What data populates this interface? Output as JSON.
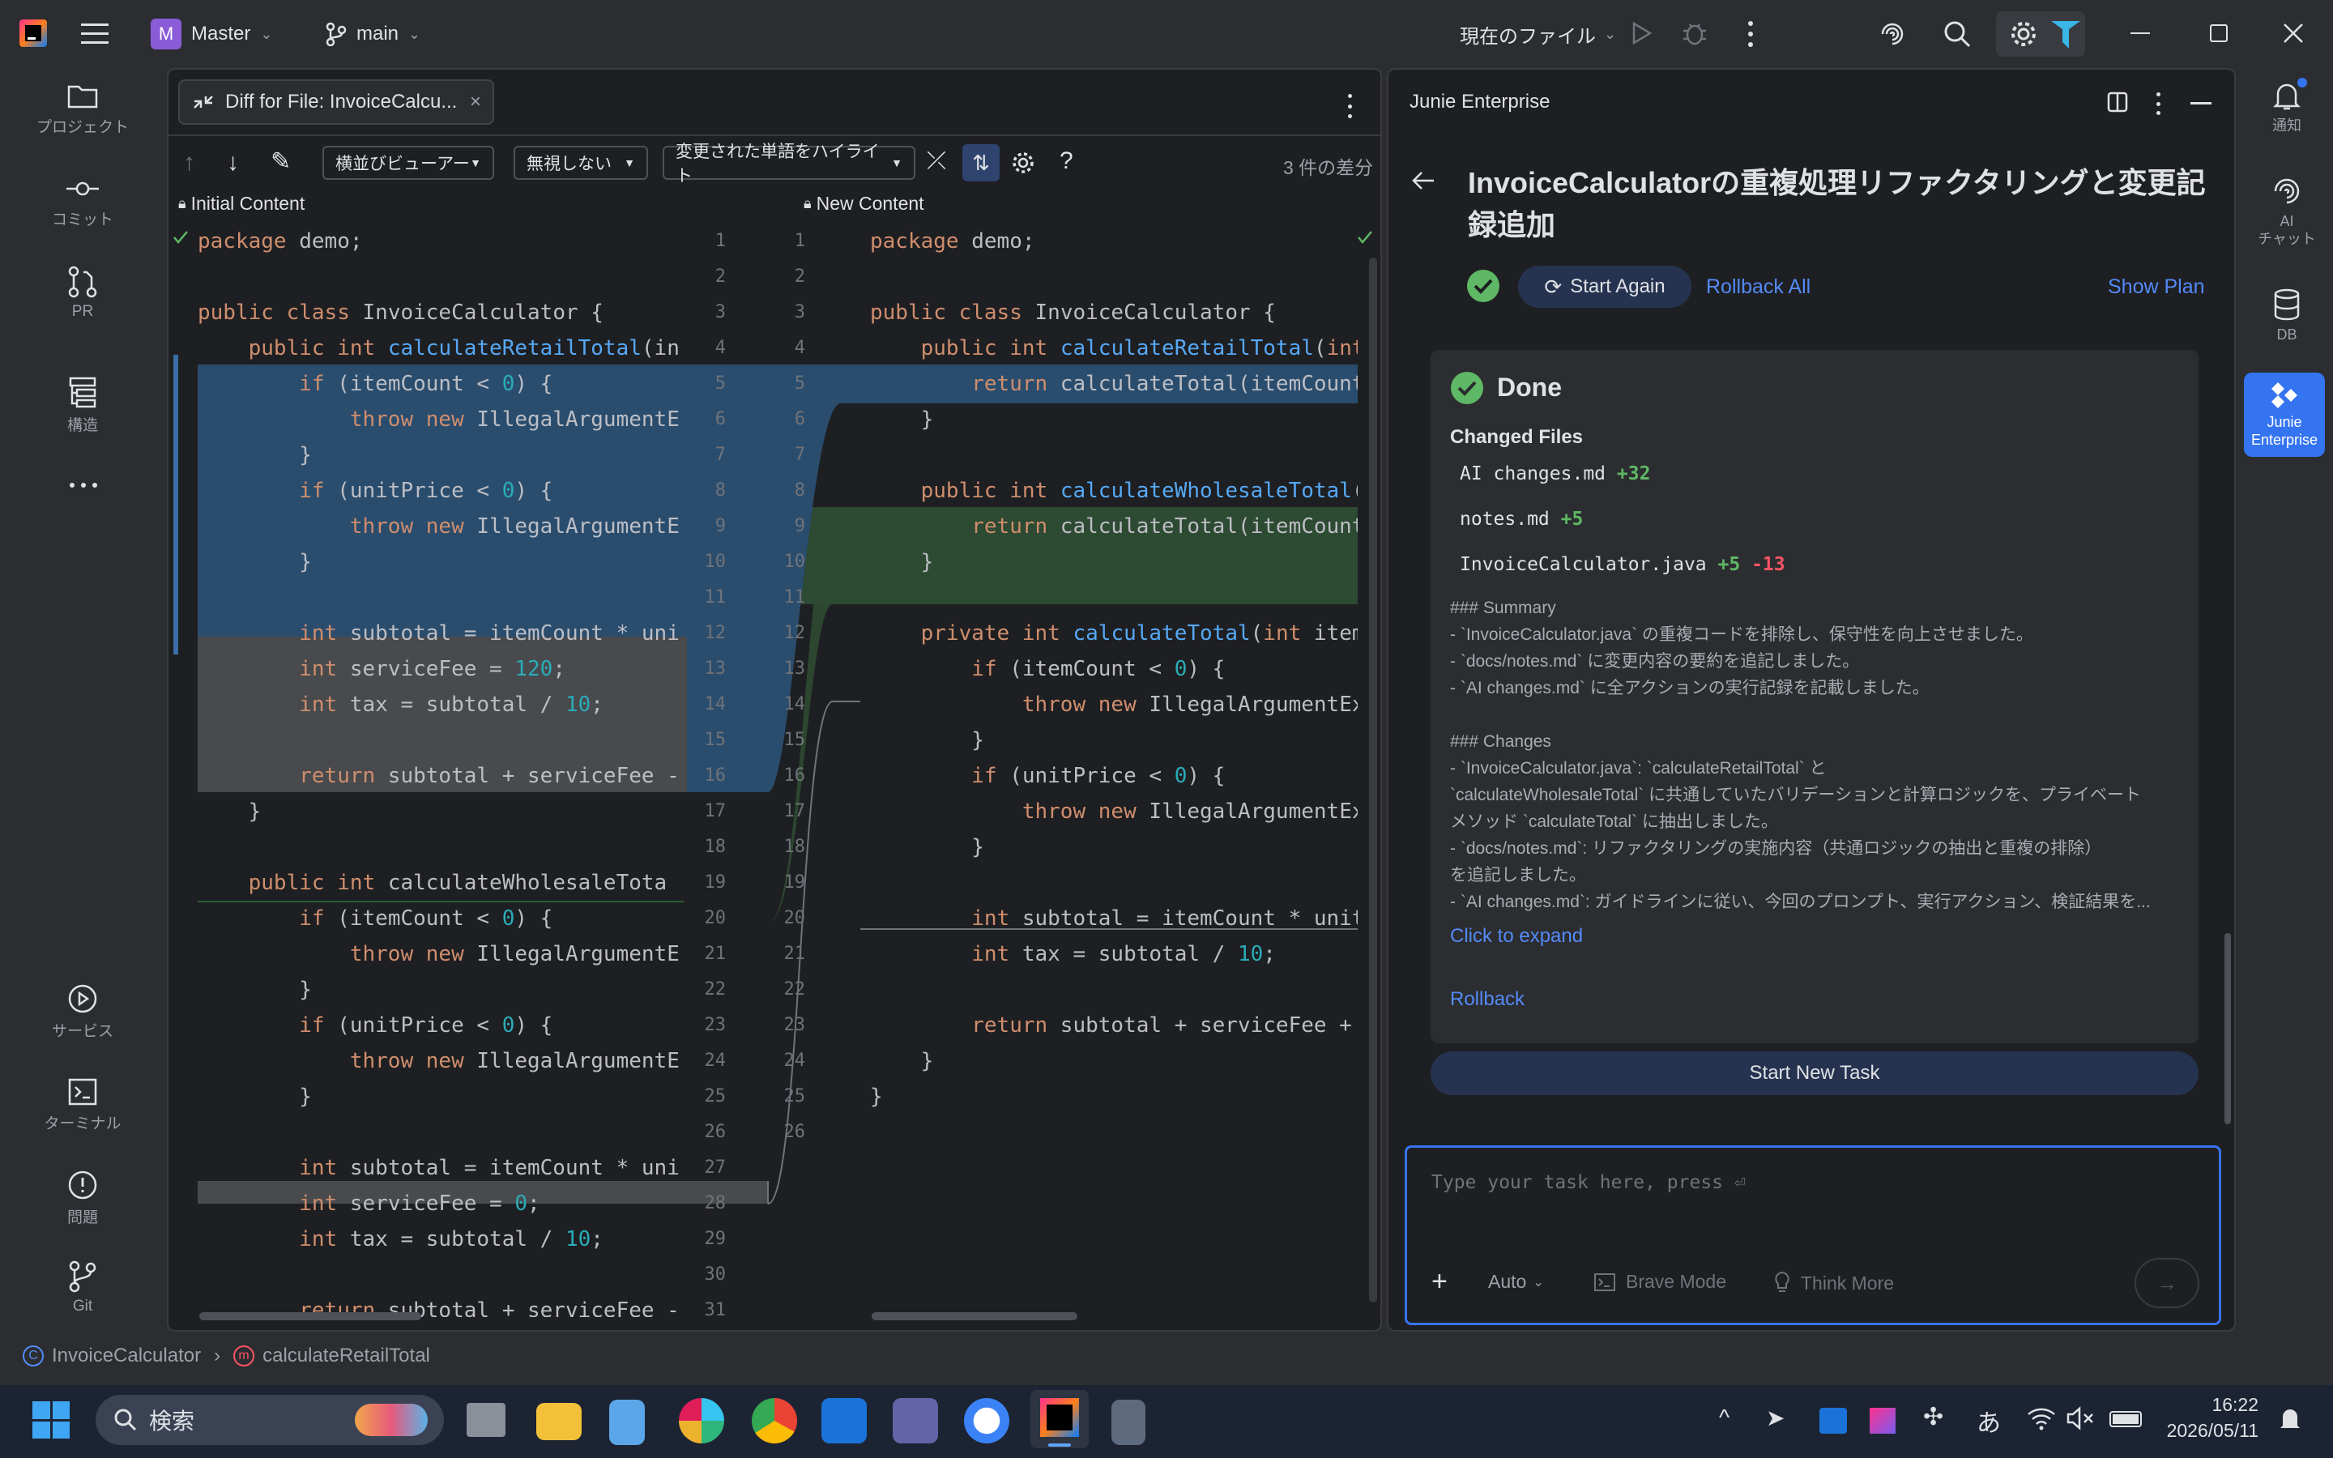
{
  "titlebar": {
    "project_badge": "M",
    "project_name": "Master",
    "branch": "main",
    "run_config": "現在のファイル"
  },
  "left_toolbar": {
    "items": [
      {
        "label": "プロジェクト",
        "icon": "folder-icon"
      },
      {
        "label": "コミット",
        "icon": "commit-icon"
      },
      {
        "label": "PR",
        "icon": "pull-request-icon"
      },
      {
        "label": "構造",
        "icon": "structure-icon"
      },
      {
        "label": "サービス",
        "icon": "services-icon"
      },
      {
        "label": "ターミナル",
        "icon": "terminal-icon"
      },
      {
        "label": "問題",
        "icon": "problems-icon"
      },
      {
        "label": "Git",
        "icon": "git-icon"
      }
    ]
  },
  "editor": {
    "tab_title": "Diff for File: InvoiceCalcu...",
    "toolbar": {
      "viewer_mode": "横並びビューアー",
      "whitespace": "無視しない",
      "highlight": "変更された単語をハイライト",
      "diff_count": "3 件の差分"
    },
    "left_header": "Initial Content",
    "right_header": "New Content",
    "left_lines": [
      "package demo;",
      "",
      "public class InvoiceCalculator {",
      "    public int calculateRetailTotal(in",
      "        if (itemCount < 0) {",
      "            throw new IllegalArgumentE",
      "        }",
      "        if (unitPrice < 0) {",
      "            throw new IllegalArgumentE",
      "        }",
      "",
      "        int subtotal = itemCount * uni",
      "        int serviceFee = 120;",
      "        int tax = subtotal / 10;",
      "",
      "        return subtotal + serviceFee -",
      "    }",
      "",
      "    public int calculateWholesaleTota",
      "        if (itemCount < 0) {",
      "            throw new IllegalArgumentE",
      "        }",
      "        if (unitPrice < 0) {",
      "            throw new IllegalArgumentE",
      "        }",
      "",
      "        int subtotal = itemCount * uni",
      "        int serviceFee = 0;",
      "        int tax = subtotal / 10;",
      "",
      "        return subtotal + serviceFee -"
    ],
    "right_lines": [
      "package demo;",
      "",
      "public class InvoiceCalculator {",
      "    public int calculateRetailTotal(int",
      "        return calculateTotal(itemCount",
      "    }",
      "",
      "    public int calculateWholesaleTotal(",
      "        return calculateTotal(itemCount",
      "    }",
      "",
      "    private int calculateTotal(int item",
      "        if (itemCount < 0) {",
      "            throw new IllegalArgumentExc",
      "        }",
      "        if (unitPrice < 0) {",
      "            throw new IllegalArgumentExc",
      "        }",
      "",
      "        int subtotal = itemCount * unitP",
      "        int tax = subtotal / 10;",
      "",
      "        return subtotal + serviceFee + t",
      "    }",
      "}",
      ""
    ]
  },
  "junie": {
    "panel_title": "Junie Enterprise",
    "task_title": "InvoiceCalculatorの重複処理リファクタリングと変更記録追加",
    "start_again": "Start Again",
    "rollback_all": "Rollback All",
    "show_plan": "Show Plan",
    "status": "Done",
    "changed_files_label": "Changed Files",
    "changed_files": [
      {
        "name": "AI changes.md",
        "added": "+32",
        "removed": ""
      },
      {
        "name": "notes.md",
        "added": "+5",
        "removed": ""
      },
      {
        "name": "InvoiceCalculator.java",
        "added": "+5",
        "removed": "-13"
      }
    ],
    "summary_lines": [
      "### Summary",
      "- `InvoiceCalculator.java` の重複コードを排除し、保守性を向上させました。",
      "- `docs/notes.md` に変更内容の要約を追記しました。",
      "- `AI changes.md` に全アクションの実行記録を記載しました。",
      "",
      "### Changes",
      "- `InvoiceCalculator.java`: `calculateRetailTotal` と",
      "`calculateWholesaleTotal` に共通していたバリデーションと計算ロジックを、プライベート",
      "メソッド `calculateTotal` に抽出しました。",
      "- `docs/notes.md`: リファクタリングの実施内容（共通ロジックの抽出と重複の排除）",
      "を追記しました。",
      "- `AI changes.md`: ガイドラインに従い、今回のプロンプト、実行アクション、検証結果を..."
    ],
    "click_to_expand": "Click to expand",
    "rollback": "Rollback",
    "start_new_task": "Start New Task",
    "input_placeholder": "Type your task here, press ⏎",
    "mode": "Auto",
    "brave_mode": "Brave Mode",
    "think_more": "Think More"
  },
  "right_bar": {
    "items": [
      {
        "label": "通知",
        "icon": "bell-icon"
      },
      {
        "label": "AI\nチャット",
        "icon": "ai-chat-icon"
      },
      {
        "label": "DB",
        "icon": "database-icon"
      },
      {
        "label": "Junie\nEnterprise",
        "icon": "junie-icon"
      }
    ]
  },
  "breadcrumb": {
    "class_name": "InvoiceCalculator",
    "method_name": "calculateRetailTotal"
  },
  "taskbar": {
    "search_placeholder": "検索",
    "time": "16:22",
    "date": "2026/05/11",
    "ime": "あ"
  },
  "colors": {
    "accent": "#548af7",
    "modified_bg": "#2a4d6e",
    "added_bg": "#2d4a32",
    "deleted_bg": "#484a4d",
    "success": "#5fb865",
    "removed": "#f75464"
  }
}
